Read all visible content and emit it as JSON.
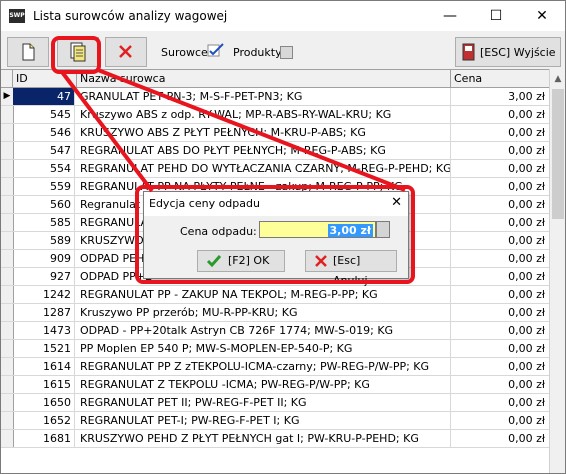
{
  "window": {
    "title": "Lista surowców analizy wagowej",
    "app_icon_text": "SWP",
    "minimize_glyph": "—",
    "maximize_glyph": "☐",
    "close_glyph": "✕"
  },
  "toolbar": {
    "surowce_label": "Surowce",
    "surowce_checked": true,
    "produkty_label": "Produkty",
    "produkty_checked": false,
    "exit_label": "[ESC] Wyjście"
  },
  "table": {
    "columns": [
      "ID",
      "Nazwa surowca",
      "Cena"
    ],
    "rows": [
      {
        "id": "47",
        "name": "GRANULAT PET PN-3; M-S-F-PET-PN3; KG",
        "price": "3,00 zł"
      },
      {
        "id": "545",
        "name": "Kruszywo ABS z odp. RY-WAL; MP-R-ABS-RY-WAL-KRU; KG",
        "price": "0,00 zł"
      },
      {
        "id": "546",
        "name": "KRUSZYWO ABS Z PŁYT PEŁNYCH; M-KRU-P-ABS; KG",
        "price": "0,00 zł"
      },
      {
        "id": "547",
        "name": "REGRANULAT ABS DO PŁYT PEŁNYCH; M-REG-P-ABS; KG",
        "price": "0,00 zł"
      },
      {
        "id": "554",
        "name": "REGRANULAT PEHD DO WYTŁACZANIA CZARNY; M-REG-P-PEHD; KG",
        "price": "0,00 zł"
      },
      {
        "id": "559",
        "name": "REGRANULAT PP NA PŁYTY PEŁNE - zakup; M-REG-P-PP; KG",
        "price": "0,00 zł"
      },
      {
        "id": "560",
        "name": "Regranulat PP",
        "price": "0,00 zł"
      },
      {
        "id": "585",
        "name": "REGRANULAT",
        "price": "0,00 zł"
      },
      {
        "id": "589",
        "name": "KRUSZYWO",
        "price": "0,00 zł"
      },
      {
        "id": "909",
        "name": "ODPAD PEH",
        "price": "0,00 zł"
      },
      {
        "id": "927",
        "name": "ODPAD PP+E",
        "price": "0,00 zł"
      },
      {
        "id": "1242",
        "name": "REGRANULAT PP - ZAKUP NA TEKPOL; M-REG-P-PP; KG",
        "price": "0,00 zł"
      },
      {
        "id": "1287",
        "name": "Kruszywo PP przerób; MU-R-PP-KRU; KG",
        "price": "0,00 zł"
      },
      {
        "id": "1473",
        "name": "ODPAD - PP+20talk Astryn CB 726F 1774; MW-S-019; KG",
        "price": "0,00 zł"
      },
      {
        "id": "1521",
        "name": "PP Moplen EP 540 P; MW-S-MOPLEN-EP-540-P; KG",
        "price": "0,00 zł"
      },
      {
        "id": "1614",
        "name": "REGRANULAT PP Z zTEKPOLU-ICMA-czarny; PW-REG-P/W-PP; KG",
        "price": "0,00 zł"
      },
      {
        "id": "1615",
        "name": "REGRANULAT Z TEKPOLU -ICMA; PW-REG-P/W-PP; KG",
        "price": "0,00 zł"
      },
      {
        "id": "1650",
        "name": "REGRANULAT PET II; PW-REG-F-PET II; KG",
        "price": "0,00 zł"
      },
      {
        "id": "1652",
        "name": "REGRANULAT PET-I; PW-REG-F-PET I; KG",
        "price": "0,00 zł"
      },
      {
        "id": "1681",
        "name": "KRUSZYWO PEHD Z PŁYT PEŁNYCH gat I; PW-KRU-P-PEHD; KG",
        "price": "0,00 zł"
      }
    ]
  },
  "dialog": {
    "title": "Edycja ceny odpadu",
    "close_glyph": "✕",
    "field_label": "Cena odpadu:",
    "field_value": "3,00 zł",
    "ok_label": "[F2] OK",
    "cancel_label": "[Esc] Anuluj"
  },
  "colors": {
    "annotation": "#e8141e",
    "selection": "#0a246a",
    "input_bg": "#ffff99",
    "text_highlight": "#3399ff"
  }
}
